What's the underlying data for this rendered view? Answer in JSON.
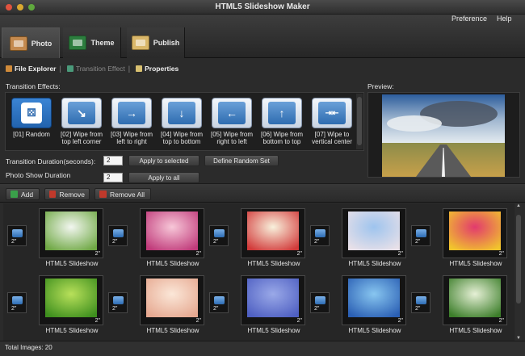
{
  "app": {
    "title": "HTML5 Slideshow Maker"
  },
  "menu": {
    "preference": "Preference",
    "help": "Help"
  },
  "tabs": [
    {
      "label": "Photo",
      "icon": "photo-icon",
      "active": true
    },
    {
      "label": "Theme",
      "icon": "theme-icon"
    },
    {
      "label": "Publish",
      "icon": "publish-icon"
    }
  ],
  "subtabs": {
    "file_explorer": "File Explorer",
    "transition_effect": "Transition Effect",
    "properties": "Properties"
  },
  "effects": {
    "label": "Transition Effects:",
    "items": [
      {
        "label": "[01] Random",
        "glyph": "⚄"
      },
      {
        "label": "[02] Wipe from top left corner",
        "glyph": "↘"
      },
      {
        "label": "[03] Wipe from left to right",
        "glyph": "→"
      },
      {
        "label": "[04] Wipe from top to bottom",
        "glyph": "↓"
      },
      {
        "label": "[05] Wipe from right to left",
        "glyph": "←"
      },
      {
        "label": "[06] Wipe from bottom to top",
        "glyph": "↑"
      },
      {
        "label": "[07] Wipe to vertical center",
        "glyph": "⇥⇤"
      }
    ]
  },
  "preview": {
    "label": "Preview:"
  },
  "durations": {
    "transition_label": "Transition Duration(seconds):",
    "transition_value": "2",
    "photo_label": "Photo Show Duration",
    "photo_value": "2",
    "apply_selected": "Apply to selected",
    "define_random": "Define Random Set",
    "apply_all": "Apply to all"
  },
  "toolbar": {
    "add": "Add",
    "remove": "Remove",
    "remove_all": "Remove All"
  },
  "grid": {
    "items": [
      {
        "label": "HTML5 Slideshow",
        "duration": "2\"",
        "trans": "2\"",
        "c1": "#f2f6f0",
        "c2": "#6fa844"
      },
      {
        "label": "HTML5 Slideshow",
        "duration": "2\"",
        "trans": "2\"",
        "c1": "#f7c7d8",
        "c2": "#c03a7a"
      },
      {
        "label": "HTML5 Slideshow",
        "duration": "2\"",
        "trans": "2\"",
        "c1": "#f8f1dc",
        "c2": "#d23a3a"
      },
      {
        "label": "HTML5 Slideshow",
        "duration": "2\"",
        "trans": "2\"",
        "c1": "#9ec4ee",
        "c2": "#e8e0e8"
      },
      {
        "label": "HTML5 Slideshow",
        "duration": "2\"",
        "trans": "2\"",
        "c1": "#e23a6e",
        "c2": "#f1c52c"
      },
      {
        "label": "HTML5 Slideshow",
        "duration": "2\"",
        "trans": "2\"",
        "c1": "#b8e05a",
        "c2": "#3e8f1e"
      },
      {
        "label": "HTML5 Slideshow",
        "duration": "2\"",
        "trans": "2\"",
        "c1": "#fbe7d8",
        "c2": "#e6a890"
      },
      {
        "label": "HTML5 Slideshow",
        "duration": "2\"",
        "trans": "2\"",
        "c1": "#9aa9e8",
        "c2": "#4e5fc2"
      },
      {
        "label": "HTML5 Slideshow",
        "duration": "2\"",
        "trans": "2\"",
        "c1": "#88c6f0",
        "c2": "#2a5fb4"
      },
      {
        "label": "HTML5 Slideshow",
        "duration": "2\"",
        "trans": "2\"",
        "c1": "#e6f0d6",
        "c2": "#3c7e2a"
      }
    ]
  },
  "status": {
    "text": "Total Images: 20"
  }
}
